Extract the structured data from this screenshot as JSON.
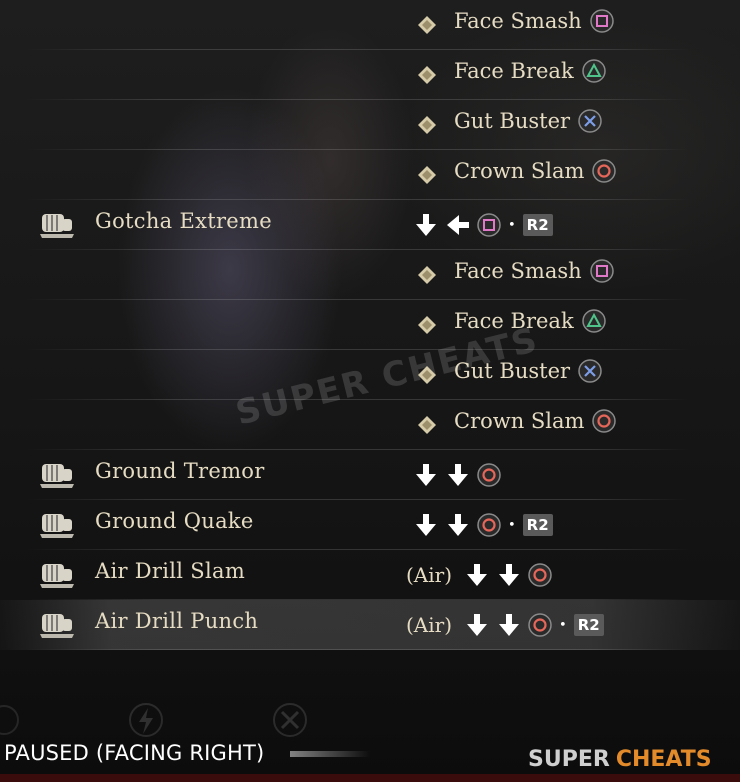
{
  "colors": {
    "text": "#e6dcc3",
    "square": "#e079c8",
    "triangle": "#4fc48a",
    "cross": "#7c9ee8",
    "circle": "#e6675a",
    "r2_bg": "#5a5a5a"
  },
  "rows": [
    {
      "kind": "sub",
      "name": "Face Smash",
      "button": "square"
    },
    {
      "kind": "sub",
      "name": "Face Break",
      "button": "triangle"
    },
    {
      "kind": "sub",
      "name": "Gut Buster",
      "button": "cross"
    },
    {
      "kind": "sub",
      "name": "Crown Slam",
      "button": "circle"
    },
    {
      "kind": "move",
      "name": "Gotcha Extreme",
      "input_start": 413,
      "inputs": [
        {
          "t": "arrow",
          "d": "down"
        },
        {
          "t": "arrow",
          "d": "left"
        },
        {
          "t": "btn",
          "b": "square"
        },
        {
          "t": "plus"
        },
        {
          "t": "r2"
        }
      ]
    },
    {
      "kind": "sub",
      "name": "Face Smash",
      "button": "square"
    },
    {
      "kind": "sub",
      "name": "Face Break",
      "button": "triangle"
    },
    {
      "kind": "sub",
      "name": "Gut Buster",
      "button": "cross"
    },
    {
      "kind": "sub",
      "name": "Crown Slam",
      "button": "circle"
    },
    {
      "kind": "move",
      "name": "Ground Tremor",
      "input_start": 413,
      "inputs": [
        {
          "t": "arrow",
          "d": "down"
        },
        {
          "t": "arrow",
          "d": "down"
        },
        {
          "t": "btn",
          "b": "circle"
        }
      ]
    },
    {
      "kind": "move",
      "name": "Ground Quake",
      "input_start": 413,
      "inputs": [
        {
          "t": "arrow",
          "d": "down"
        },
        {
          "t": "arrow",
          "d": "down"
        },
        {
          "t": "btn",
          "b": "circle"
        },
        {
          "t": "plus"
        },
        {
          "t": "r2"
        }
      ]
    },
    {
      "kind": "move",
      "name": "Air Drill Slam",
      "input_start": 406,
      "air": "(Air)",
      "inputs": [
        {
          "t": "arrow",
          "d": "down"
        },
        {
          "t": "arrow",
          "d": "down"
        },
        {
          "t": "btn",
          "b": "circle"
        }
      ]
    },
    {
      "kind": "move",
      "name": "Air Drill Punch",
      "input_start": 406,
      "air": "(Air)",
      "selected": true,
      "inputs": [
        {
          "t": "arrow",
          "d": "down"
        },
        {
          "t": "arrow",
          "d": "down"
        },
        {
          "t": "btn",
          "b": "circle"
        },
        {
          "t": "plus"
        },
        {
          "t": "r2"
        }
      ]
    }
  ],
  "r2_label": "R2",
  "plus_glyph": "•",
  "status": {
    "paused_label": "PAUSED (FACING RIGHT)"
  },
  "watermarks": {
    "center": "SUPER CHEATS",
    "corner_a": "SUPER",
    "corner_b": "CHEATS"
  },
  "bottom_icons": [
    "lightning-icon",
    "cross-icon"
  ]
}
